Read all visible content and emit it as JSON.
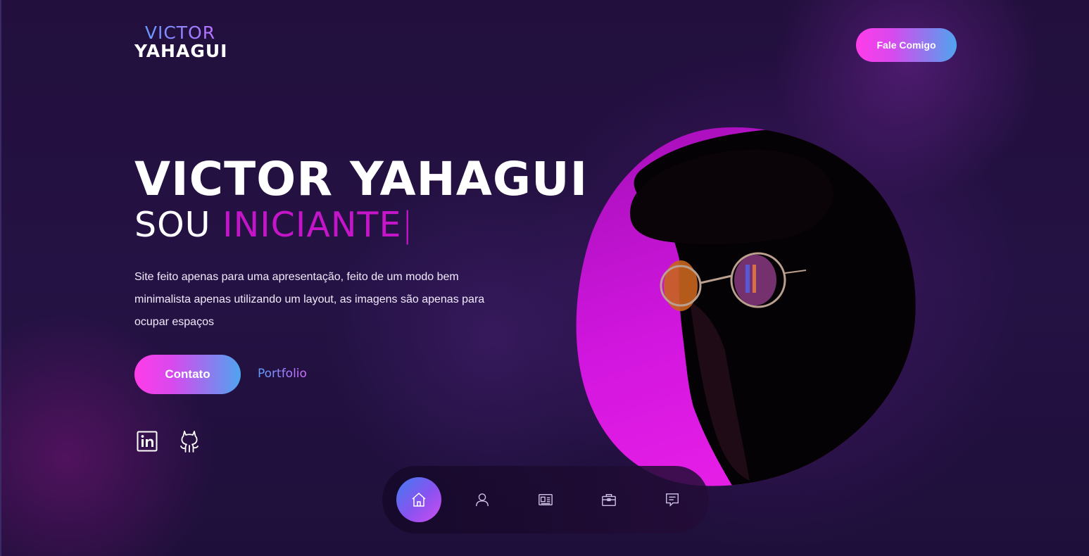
{
  "header": {
    "logo_line1": "VICTOR",
    "logo_line2": "YAHAGUI",
    "cta_label": "Fale Comigo"
  },
  "hero": {
    "title": "VICTOR YAHAGUI",
    "subtitle_static": "SOU ",
    "subtitle_typed": "INICIANTE",
    "cursor": "|",
    "description": "Site feito apenas para uma apresentação, feito de um modo bem minimalista apenas utilizando um layout, as imagens são apenas para ocupar espaços",
    "primary_button": "Contato",
    "secondary_link": "Portfolio"
  },
  "social": [
    {
      "icon": "linkedin-icon"
    },
    {
      "icon": "github-icon"
    }
  ],
  "nav": {
    "items": [
      {
        "icon": "home-icon",
        "active": true
      },
      {
        "icon": "user-icon",
        "active": false
      },
      {
        "icon": "resume-icon",
        "active": false
      },
      {
        "icon": "briefcase-icon",
        "active": false
      },
      {
        "icon": "message-icon",
        "active": false
      }
    ]
  },
  "colors": {
    "background": "#220f3d",
    "accent_magenta": "#c415c9",
    "gradient_start": "#ff3ce8",
    "gradient_end": "#4fa4ef"
  }
}
